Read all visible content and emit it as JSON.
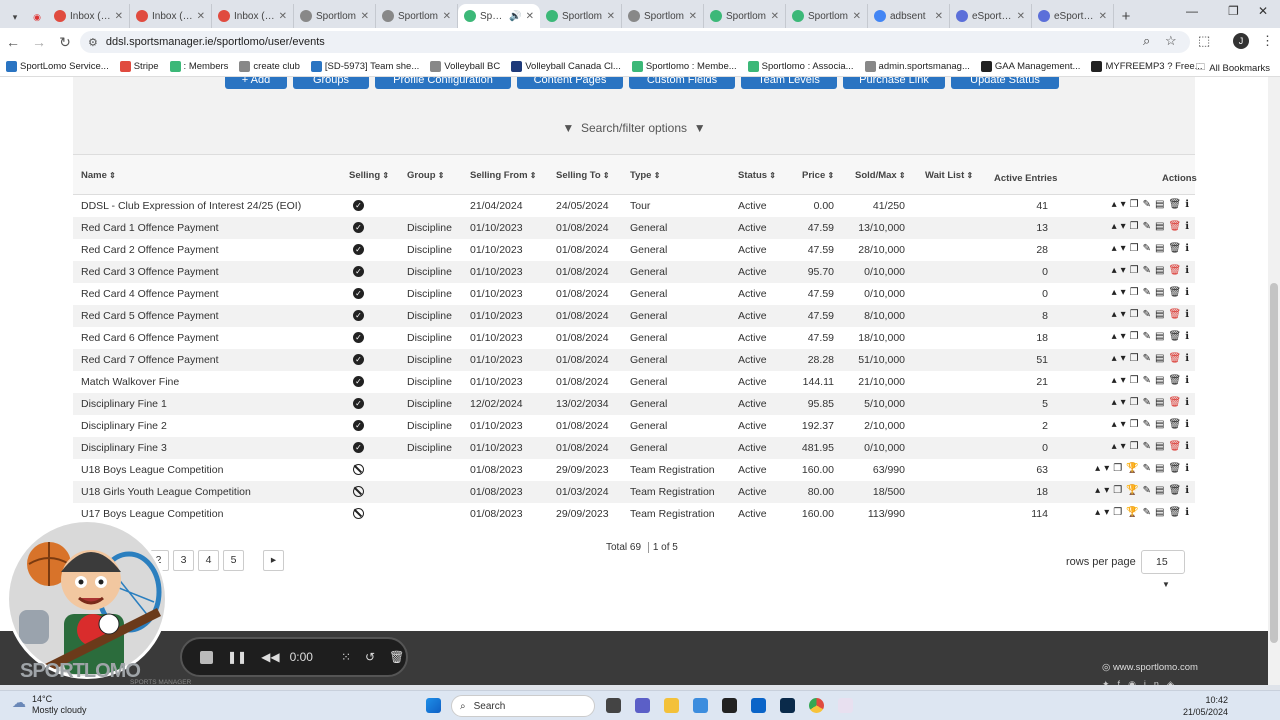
{
  "browser": {
    "tabs": [
      {
        "title": "Inbox (1,2",
        "color": "#e04b3f",
        "active": false
      },
      {
        "title": "Inbox (4,5",
        "color": "#e04b3f",
        "active": false
      },
      {
        "title": "Inbox (4,5",
        "color": "#e04b3f",
        "active": false
      },
      {
        "title": "Sportlom",
        "color": "#888888",
        "active": false
      },
      {
        "title": "Sportlom",
        "color": "#888888",
        "active": false
      },
      {
        "title": "Sporti",
        "color": "#3cb878",
        "active": true
      },
      {
        "title": "Sportlom",
        "color": "#3cb878",
        "active": false
      },
      {
        "title": "Sportlom",
        "color": "#888888",
        "active": false
      },
      {
        "title": "Sportlom",
        "color": "#3cb878",
        "active": false
      },
      {
        "title": "Sportlom",
        "color": "#3cb878",
        "active": false
      },
      {
        "title": "adbsent",
        "color": "#4285f4",
        "active": false
      },
      {
        "title": "eSports M",
        "color": "#5b6fd9",
        "active": false
      },
      {
        "title": "eSports M",
        "color": "#5b6fd9",
        "active": false
      }
    ],
    "url": "ddsl.sportsmanager.ie/sportlomo/user/events",
    "profile_initial": "J",
    "bookmarks": [
      {
        "label": "SportLomo Service...",
        "color": "#2a74c2"
      },
      {
        "label": "Stripe",
        "color": "#e04b3f"
      },
      {
        "label": ": Members",
        "color": "#3cb878"
      },
      {
        "label": "create club",
        "color": "#888888"
      },
      {
        "label": "[SD-5973] Team she...",
        "color": "#2a74c2"
      },
      {
        "label": "Volleyball BC",
        "color": "#888888"
      },
      {
        "label": "Volleyball Canada Cl...",
        "color": "#1e3a7a"
      },
      {
        "label": "Sportlomo : Membe...",
        "color": "#3cb878"
      },
      {
        "label": "Sportlomo : Associa...",
        "color": "#3cb878"
      },
      {
        "label": "admin.sportsmanag...",
        "color": "#888888"
      },
      {
        "label": "GAA Management...",
        "color": "#222222"
      },
      {
        "label": "MYFREEMP3 ? Free...",
        "color": "#222222"
      }
    ],
    "all_bookmarks": "All Bookmarks"
  },
  "toolbar": {
    "buttons": [
      "+ Add",
      "Groups",
      "Profile Configuration",
      "Content Pages",
      "Custom Fields",
      "Team Levels",
      "Purchase Link",
      "Update Status"
    ],
    "search_filter": "Search/filter options"
  },
  "table": {
    "headers": [
      "Name",
      "Selling",
      "Group",
      "Selling From",
      "Selling To",
      "Type",
      "Status",
      "Price",
      "Sold/Max",
      "Wait List",
      "Active Entries",
      "Actions"
    ],
    "rows": [
      {
        "name": "DDSL - Club Expression of Interest 24/25 (EOI)",
        "selling": true,
        "group": "",
        "from": "21/04/2024",
        "to": "24/05/2024",
        "type": "Tour",
        "status": "Active",
        "price": "0.00",
        "sold": "41/250",
        "active": "41",
        "team": false
      },
      {
        "name": "Red Card 1 Offence Payment",
        "selling": true,
        "group": "Discipline",
        "from": "01/10/2023",
        "to": "01/08/2024",
        "type": "General",
        "status": "Active",
        "price": "47.59",
        "sold": "13/10,000",
        "active": "13",
        "team": false
      },
      {
        "name": "Red Card 2 Offence Payment",
        "selling": true,
        "group": "Discipline",
        "from": "01/10/2023",
        "to": "01/08/2024",
        "type": "General",
        "status": "Active",
        "price": "47.59",
        "sold": "28/10,000",
        "active": "28",
        "team": false
      },
      {
        "name": "Red Card 3 Offence Payment",
        "selling": true,
        "group": "Discipline",
        "from": "01/10/2023",
        "to": "01/08/2024",
        "type": "General",
        "status": "Active",
        "price": "95.70",
        "sold": "0/10,000",
        "active": "0",
        "team": false
      },
      {
        "name": "Red Card 4 Offence Payment",
        "selling": true,
        "group": "Discipline",
        "from": "01/10/2023",
        "to": "01/08/2024",
        "type": "General",
        "status": "Active",
        "price": "47.59",
        "sold": "0/10,000",
        "active": "0",
        "team": false
      },
      {
        "name": "Red Card 5 Offence Payment",
        "selling": true,
        "group": "Discipline",
        "from": "01/10/2023",
        "to": "01/08/2024",
        "type": "General",
        "status": "Active",
        "price": "47.59",
        "sold": "8/10,000",
        "active": "8",
        "team": false
      },
      {
        "name": "Red Card 6 Offence Payment",
        "selling": true,
        "group": "Discipline",
        "from": "01/10/2023",
        "to": "01/08/2024",
        "type": "General",
        "status": "Active",
        "price": "47.59",
        "sold": "18/10,000",
        "active": "18",
        "team": false
      },
      {
        "name": "Red Card 7 Offence Payment",
        "selling": true,
        "group": "Discipline",
        "from": "01/10/2023",
        "to": "01/08/2024",
        "type": "General",
        "status": "Active",
        "price": "28.28",
        "sold": "51/10,000",
        "active": "51",
        "team": false
      },
      {
        "name": "Match Walkover Fine",
        "selling": true,
        "group": "Discipline",
        "from": "01/10/2023",
        "to": "01/08/2024",
        "type": "General",
        "status": "Active",
        "price": "144.11",
        "sold": "21/10,000",
        "active": "21",
        "team": false
      },
      {
        "name": "Disciplinary Fine 1",
        "selling": true,
        "group": "Discipline",
        "from": "12/02/2024",
        "to": "13/02/2034",
        "type": "General",
        "status": "Active",
        "price": "95.85",
        "sold": "5/10,000",
        "active": "5",
        "team": false
      },
      {
        "name": "Disciplinary Fine 2",
        "selling": true,
        "group": "Discipline",
        "from": "01/10/2023",
        "to": "01/08/2024",
        "type": "General",
        "status": "Active",
        "price": "192.37",
        "sold": "2/10,000",
        "active": "2",
        "team": false
      },
      {
        "name": "Disciplinary Fine 3",
        "selling": true,
        "group": "Discipline",
        "from": "01/10/2023",
        "to": "01/08/2024",
        "type": "General",
        "status": "Active",
        "price": "481.95",
        "sold": "0/10,000",
        "active": "0",
        "team": false
      },
      {
        "name": "U18 Boys League Competition",
        "selling": false,
        "group": "",
        "from": "01/08/2023",
        "to": "29/09/2023",
        "type": "Team Registration",
        "status": "Active",
        "price": "160.00",
        "sold": "63/990",
        "active": "63",
        "team": true
      },
      {
        "name": "U18 Girls Youth League Competition",
        "selling": false,
        "group": "",
        "from": "01/08/2023",
        "to": "01/03/2024",
        "type": "Team Registration",
        "status": "Active",
        "price": "80.00",
        "sold": "18/500",
        "active": "18",
        "team": true
      },
      {
        "name": "U17 Boys League Competition",
        "selling": false,
        "group": "",
        "from": "01/08/2023",
        "to": "29/09/2023",
        "type": "Team Registration",
        "status": "Active",
        "price": "160.00",
        "sold": "113/990",
        "active": "114",
        "team": true
      }
    ]
  },
  "pagination": {
    "pages": [
      "2",
      "3",
      "4",
      "5"
    ],
    "next": "▸",
    "total": "Total 69",
    "of": "1 of 5",
    "rows_per_page_label": "rows per page",
    "rows_per_page": "15"
  },
  "footer": {
    "domain": "www.sportlomo.com"
  },
  "recorder": {
    "time": "0:00"
  },
  "branding": {
    "logo_text": "SPORTLOMO",
    "logo_sub": "SPORTS MANAGER"
  },
  "taskbar": {
    "temperature": "14°C",
    "weather": "Mostly cloudy",
    "search": "Search",
    "time": "10:42",
    "date": "21/05/2024"
  }
}
